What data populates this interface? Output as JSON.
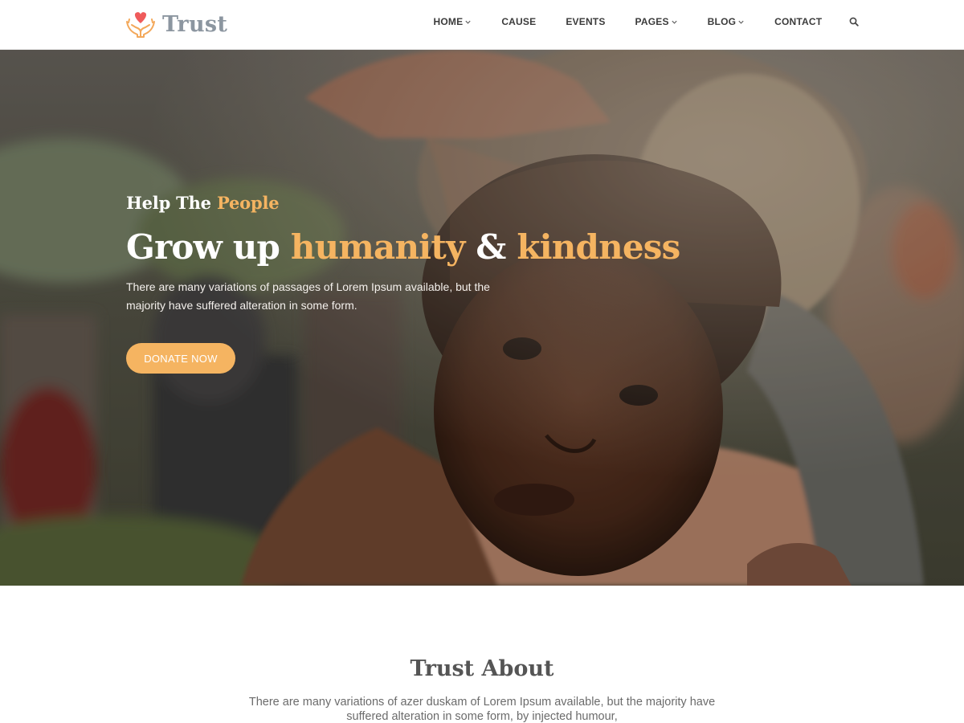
{
  "brand": {
    "name": "Trust",
    "logo_icon": "heart-in-hands-icon",
    "colors": {
      "accent": "#f5b461",
      "heart": "#ef5b5b",
      "logo_text": "#8c96a0"
    }
  },
  "nav": {
    "items": [
      {
        "label": "HOME",
        "dropdown": true
      },
      {
        "label": "CAUSE",
        "dropdown": false
      },
      {
        "label": "EVENTS",
        "dropdown": false
      },
      {
        "label": "PAGES",
        "dropdown": true
      },
      {
        "label": "BLOG",
        "dropdown": true
      },
      {
        "label": "CONTACT",
        "dropdown": false
      }
    ],
    "search_icon": "search-icon"
  },
  "hero": {
    "subtitle_prefix": "Help The",
    "subtitle_accent": "People",
    "title_part1": "Grow up",
    "title_accent1": "humanity",
    "title_amp": "&",
    "title_accent2": "kindness",
    "description": "There are many variations of passages of Lorem Ipsum available, but the majority have suffered alteration in some form.",
    "cta_label": "DONATE NOW"
  },
  "about": {
    "title": "Trust About",
    "text": "There are many variations of azer duskam of Lorem Ipsum available, but the majority have suffered alteration in some form, by injected humour,"
  }
}
